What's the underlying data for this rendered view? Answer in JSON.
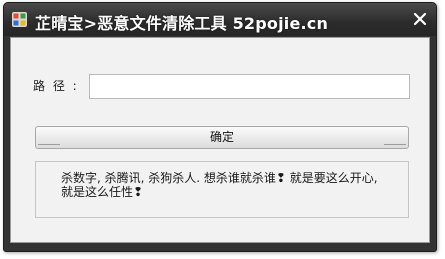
{
  "window": {
    "title": "芷晴宝>恶意文件清除工具 52pojie.cn"
  },
  "form": {
    "path_label": "路 径 :",
    "path_value": "",
    "ok_label": "确定"
  },
  "message": {
    "text": "杀数字, 杀腾讯, 杀狗杀人. 想杀谁就杀谁❢ 就是要这么开心, 就是这么任性❢"
  },
  "colors": {
    "titlebar": "#333333",
    "client_bg": "#f2f2f2",
    "title_text": "#ffffff"
  },
  "icons": {
    "app": "app-icon",
    "close": "close-icon"
  }
}
